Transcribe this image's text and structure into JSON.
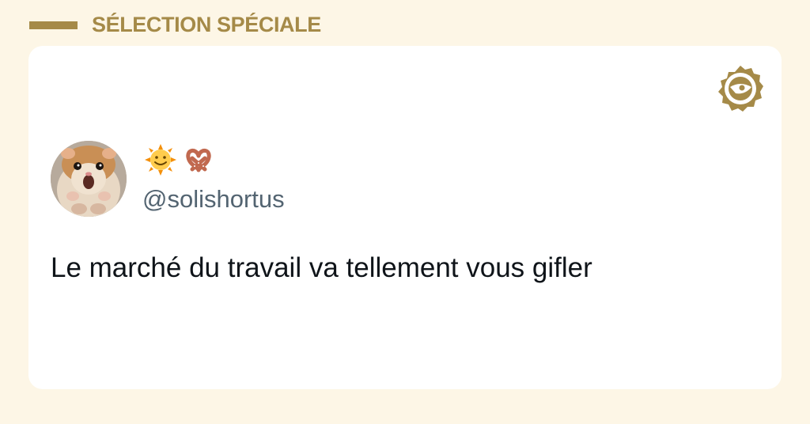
{
  "header": {
    "title": "SÉLECTION SPÉCIALE"
  },
  "brand": {
    "icon": "brand-badge-icon",
    "color": "#a58a48"
  },
  "tweet": {
    "avatar_icon": "hamster-avatar",
    "display_name_emojis": [
      "sun-with-face-emoji",
      "pretzel-emoji"
    ],
    "handle": "@solishortus",
    "text": "Le marché du travail va tellement vous gifler"
  },
  "colors": {
    "page_background": "#fdf6e6",
    "card_background": "#ffffff",
    "accent": "#a58a48",
    "handle_text": "#536471",
    "body_text": "#0f1419"
  }
}
